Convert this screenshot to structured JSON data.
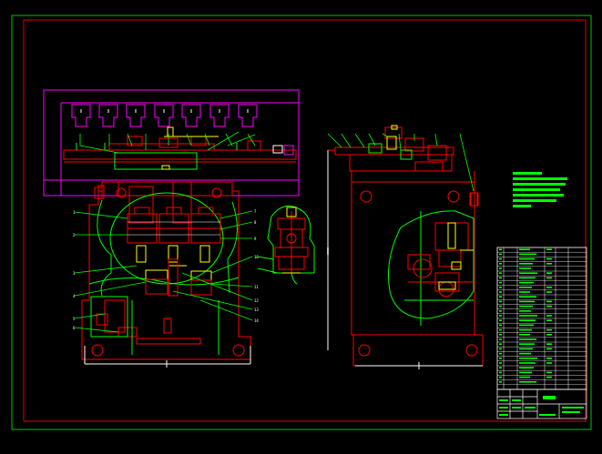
{
  "drawing": {
    "type": "cad-assembly-drawing",
    "background": "#000000",
    "colors": {
      "frame": "#00c800",
      "inner_frame": "#ff0000",
      "red": "#ff0000",
      "green": "#00ff00",
      "yellow": "#ffff00",
      "magenta": "#ff00ff",
      "white": "#ffffff",
      "cyan": "#00ffff"
    },
    "side_marker": "|",
    "title_block": {
      "label_text": ""
    }
  }
}
